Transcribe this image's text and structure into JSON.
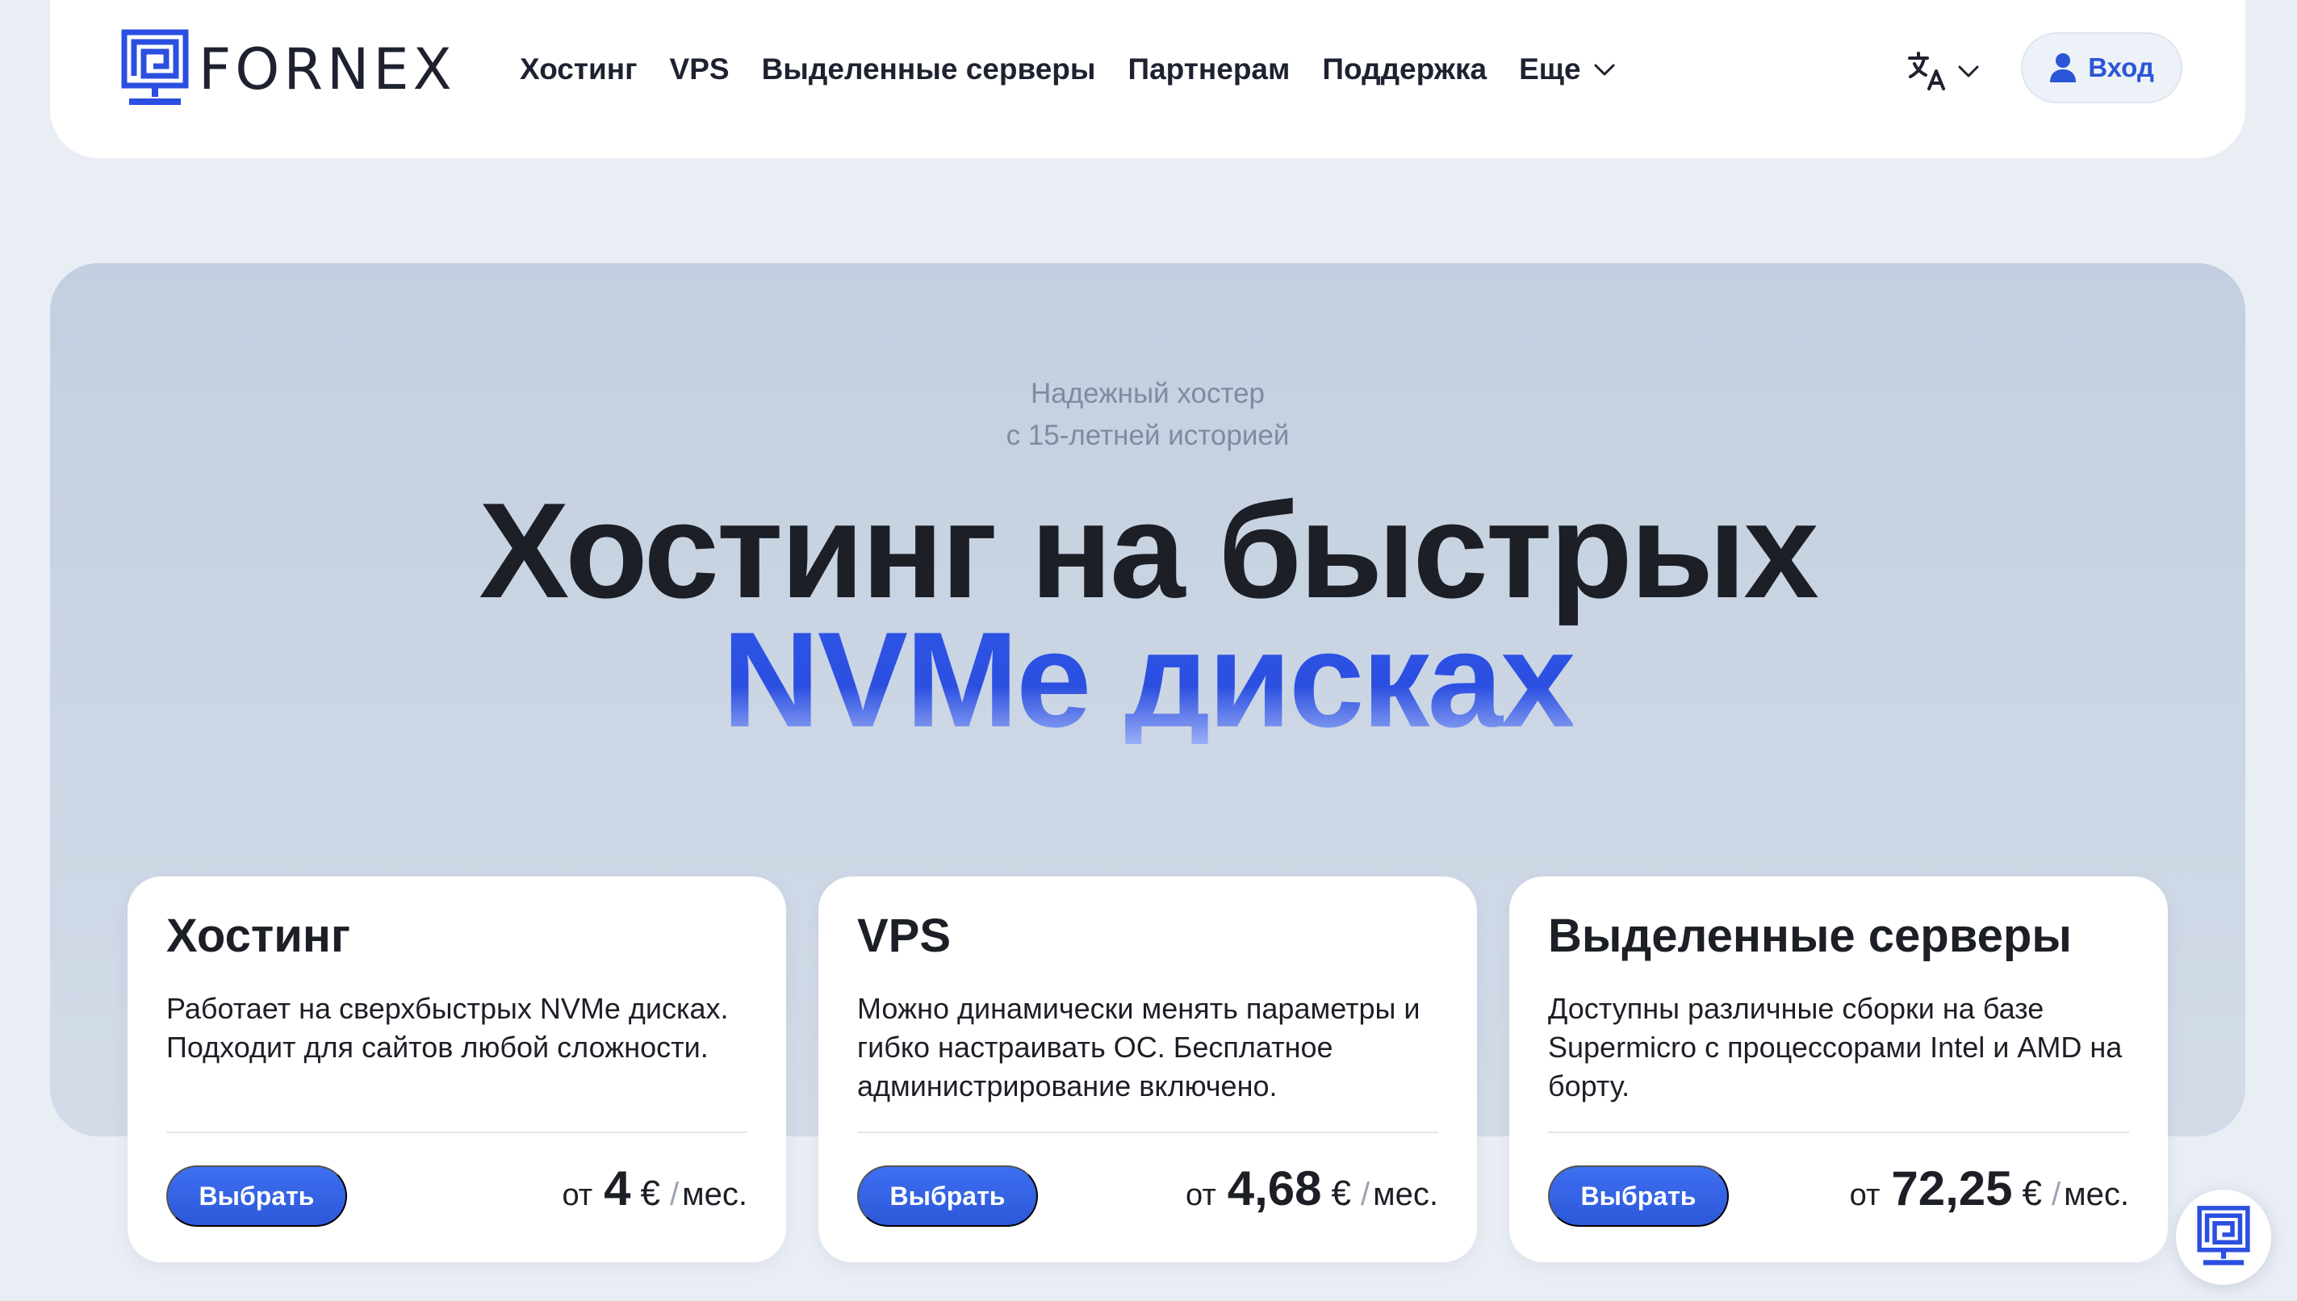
{
  "brand": {
    "name": "FORNEX",
    "accent": "#2b4fe0"
  },
  "nav": {
    "items": [
      {
        "label": "Хостинг"
      },
      {
        "label": "VPS"
      },
      {
        "label": "Выделенные серверы"
      },
      {
        "label": "Партнерам"
      },
      {
        "label": "Поддержка"
      },
      {
        "label": "Еще"
      }
    ],
    "language_icon": "translate-icon",
    "login_label": "Вход"
  },
  "hero": {
    "tagline_line1": "Надежный хостер",
    "tagline_line2": "с 15-летней историей",
    "headline_line1": "Хостинг на быстрых",
    "headline_line2": "NVMe дисках"
  },
  "cards": [
    {
      "title": "Хостинг",
      "description": "Работает на сверхбыстрых NVMe дисках. Подходит для сайтов любой сложности.",
      "button": "Выбрать",
      "price_prefix": "от",
      "price": "4",
      "currency": "€",
      "period": "мес."
    },
    {
      "title": "VPS",
      "description": "Можно динамически менять параметры и гибко настраивать ОС. Бесплатное администрирование включено.",
      "button": "Выбрать",
      "price_prefix": "от",
      "price": "4,68",
      "currency": "€",
      "period": "мес."
    },
    {
      "title": "Выделенные серверы",
      "description": "Доступны различные сборки на базе Supermicro с процессорами Intel и AMD на борту.",
      "button": "Выбрать",
      "price_prefix": "от",
      "price": "72,25",
      "currency": "€",
      "period": "мес."
    }
  ]
}
